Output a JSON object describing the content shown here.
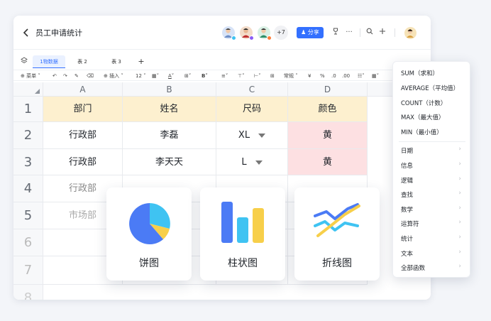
{
  "header": {
    "doc_title": "员工申请统计",
    "more_collaborators": "+7",
    "share_label": "分享"
  },
  "tabs": [
    {
      "label": "1物数据",
      "active": true
    },
    {
      "label": "表 2",
      "active": false
    },
    {
      "label": "表 3",
      "active": false
    }
  ],
  "toolbar": {
    "menu_label": "菜单",
    "insert_label": "插入",
    "font_size": "12",
    "number_format": "常规"
  },
  "sheet": {
    "columns": [
      "A",
      "B",
      "C",
      "D"
    ],
    "rows": [
      "1",
      "2",
      "3",
      "4",
      "5",
      "6",
      "7",
      "8"
    ],
    "header_row": [
      "部门",
      "姓名",
      "尺码",
      "颜色"
    ],
    "data": [
      [
        "行政部",
        "李磊",
        "XL",
        "黄"
      ],
      [
        "行政部",
        "李天天",
        "L",
        "黄"
      ],
      [
        "行政部",
        "",
        "",
        ""
      ],
      [
        "市场部",
        "",
        "",
        ""
      ]
    ]
  },
  "chart_cards": [
    {
      "label": "饼图",
      "icon": "pie-chart-icon"
    },
    {
      "label": "柱状图",
      "icon": "bar-chart-icon"
    },
    {
      "label": "折线图",
      "icon": "line-chart-icon"
    }
  ],
  "function_menu": {
    "quick": [
      "SUM（求和）",
      "AVERAGE（平均值）",
      "COUNT（计数）",
      "MAX（最大值）",
      "MIN（最小值）"
    ],
    "categories": [
      "日期",
      "信息",
      "逻辑",
      "查找",
      "数学",
      "运算符",
      "统计",
      "文本",
      "全部函数"
    ]
  },
  "colors": {
    "accent": "#3370ff",
    "header_fill": "#fdf0cf",
    "highlight_fill": "#fde0e2",
    "pie_blue": "#4b7bf5",
    "pie_cyan": "#3fc3f2",
    "pie_yellow": "#f7cf4a"
  }
}
